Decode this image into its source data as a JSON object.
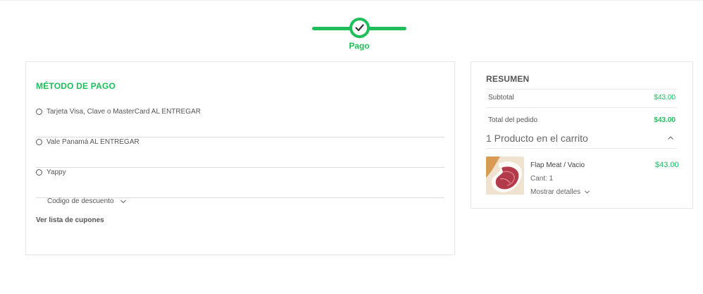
{
  "checkout_step": {
    "label": "Pago",
    "status_icon": "check-icon"
  },
  "payment": {
    "title": "MÉTODO DE PAGO",
    "options": [
      {
        "label": "Tarjeta Visa, Clave o MasterCard AL ENTREGAR",
        "selected": false
      },
      {
        "label": "Vale Panamá AL ENTREGAR",
        "selected": false
      },
      {
        "label": "Yappy",
        "selected": false
      }
    ],
    "discount_label": "Codigo de descuento",
    "coupons_link": "Ver lista de cupones"
  },
  "summary": {
    "title": "RESUMEN",
    "subtotal_label": "Subtotal",
    "subtotal_value": "$43.00",
    "total_label": "Total del pedido",
    "total_value": "$43.00",
    "cart_heading": "1 Producto en el carrito",
    "product": {
      "name": "Flap Meat / Vacio",
      "price": "$43.00",
      "qty": "Cant: 1",
      "details_label": "Mostrar detalles"
    }
  },
  "colors": {
    "accent": "#1fbe5a",
    "text": "#555555",
    "border": "#e6e6e6"
  }
}
